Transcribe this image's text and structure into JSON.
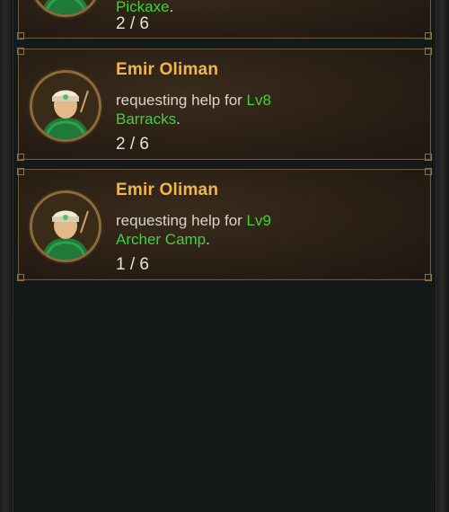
{
  "requests": [
    {
      "name": "",
      "prefix": "",
      "level": "",
      "building": "Pickaxe",
      "suffix": ".",
      "progress": "2 / 6"
    },
    {
      "name": "Emir Oliman",
      "prefix": "requesting help for ",
      "level": "Lv8",
      "building": "Barracks",
      "suffix": ".",
      "progress": "2 / 6"
    },
    {
      "name": "Emir Oliman",
      "prefix": "requesting help for ",
      "level": "Lv9",
      "building": "Archer Camp",
      "suffix": ".",
      "progress": "1 / 6"
    }
  ],
  "colors": {
    "name": "#f0b64a",
    "highlight": "#3fd13a",
    "text": "#d8d4c8",
    "card_border": "#6a5a3a"
  },
  "icons": {
    "avatar": "hero-portrait-icon"
  }
}
